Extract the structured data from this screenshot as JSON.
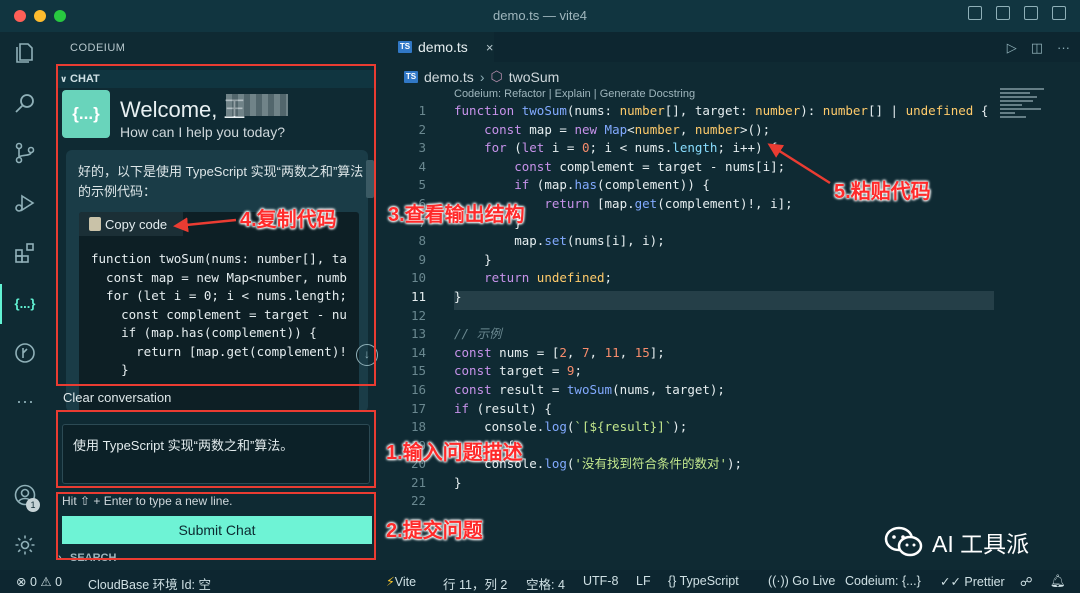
{
  "window": {
    "title": "demo.ts — vite4",
    "traffic": [
      "#ff5f57",
      "#febc2e",
      "#28c840"
    ]
  },
  "sidebar": {
    "title": "CODEIUM",
    "chat_header": "CHAT",
    "logo_text": "{...}",
    "welcome_title": "Welcome, 王",
    "welcome_sub": "How can I help you today?",
    "answer_intro": "好的，以下是使用 TypeScript 实现“两数之和”算法的示例代码：",
    "copy_label": "Copy code",
    "code_lines": [
      "function twoSum(nums: number[], ta",
      "  const map = new Map<number, numb",
      "  for (let i = 0; i < nums.length;",
      "    const complement = target - nu",
      "    if (map.has(complement)) {",
      "      return [map.get(complement)!",
      "    }"
    ],
    "clear_label": "Clear conversation",
    "input_value": "使用 TypeScript 实现“两数之和”算法。",
    "hint": "Hit ⇧ + Enter to type a new line.",
    "submit_label": "Submit Chat",
    "search_header": "SEARCH"
  },
  "editor": {
    "tab_label": "demo.ts",
    "tab_badge": "TS",
    "breadcrumb_file": "demo.ts",
    "breadcrumb_symbol": "twoSum",
    "codelens": "Codeium: Refactor | Explain | Generate Docstring",
    "line_numbers": [
      "1",
      "2",
      "3",
      "4",
      "5",
      "6",
      "7",
      "8",
      "9",
      "10",
      "11",
      "12",
      "13",
      "14",
      "15",
      "16",
      "17",
      "18",
      "19",
      "20",
      "21",
      "22"
    ],
    "current_line": "11"
  },
  "status": {
    "errors": "0",
    "warnings": "0",
    "cloudbase": "CloudBase 环境 Id: 空",
    "vite": "Vite",
    "position": "行 11，列 2",
    "spaces": "空格: 4",
    "encoding": "UTF-8",
    "eol": "LF",
    "language": "TypeScript",
    "golive": "Go Live",
    "codeium": "Codeium: {...}",
    "prettier": "Prettier"
  },
  "annotations": {
    "step1": "1.输入问题描述",
    "step2": "2.提交问题",
    "step3": "3.查看输出结构",
    "step4": "4.复制代码",
    "step5": "5.粘贴代码"
  },
  "watermark": "AI 工具派",
  "colors": {
    "accent": "#6ef3d5",
    "annotation_red": "#ea3c32",
    "bg": "#0f2a33"
  }
}
